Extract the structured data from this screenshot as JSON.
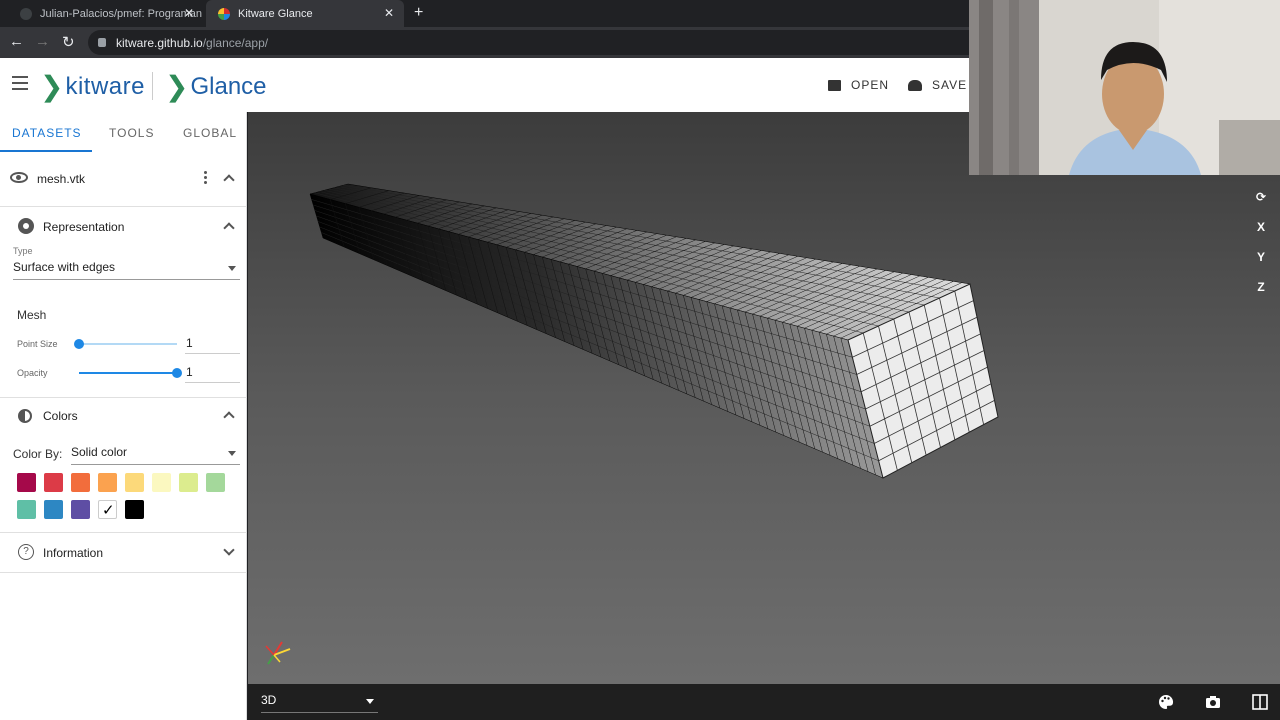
{
  "browser": {
    "tabs": [
      {
        "title": "Julian-Palacios/pmef: Programan"
      },
      {
        "title": "Kitware Glance"
      }
    ],
    "url_host": "kitware.github.io",
    "url_path": "/glance/app/"
  },
  "app": {
    "brand": "kitware",
    "product": "Glance",
    "actions": {
      "open": "OPEN",
      "save": "SAVE S"
    }
  },
  "sidebar": {
    "tabs": [
      "DATASETS",
      "TOOLS",
      "GLOBAL"
    ],
    "dataset": {
      "name": "mesh.vtk"
    },
    "representation": {
      "title": "Representation",
      "type_label": "Type",
      "type_value": "Surface with edges",
      "mesh_label": "Mesh",
      "point_size_label": "Point Size",
      "point_size_value": "1",
      "opacity_label": "Opacity",
      "opacity_value": "1"
    },
    "colors": {
      "title": "Colors",
      "color_by_label": "Color By:",
      "color_by_value": "Solid color",
      "palette": [
        "#a5094a",
        "#dc3b47",
        "#f26d3c",
        "#fba24f",
        "#fcd97a",
        "#fbf8c0",
        "#dcec8e",
        "#a4d89b",
        "#5fbfa6",
        "#2d87c3",
        "#5e4ea4",
        "#ffffff",
        "#000000"
      ],
      "selected_index": 11
    },
    "information": {
      "title": "Information"
    }
  },
  "viewport": {
    "axes_buttons": [
      "X",
      "Y",
      "Z"
    ],
    "view_mode": "3D"
  }
}
